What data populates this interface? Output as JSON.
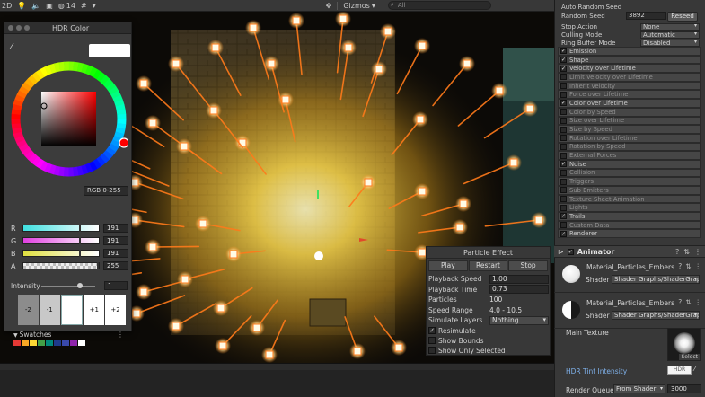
{
  "toolbar": {
    "layer_label": "2D",
    "fx_count": "14",
    "gizmos_label": "Gizmos",
    "search_placeholder": "All"
  },
  "hdr_color": {
    "title": "HDR Color",
    "color_model": "RGB 0-255",
    "channels": [
      {
        "label": "R",
        "value": "191",
        "fraction": 0.75
      },
      {
        "label": "G",
        "value": "191",
        "fraction": 0.75
      },
      {
        "label": "B",
        "value": "191",
        "fraction": 0.75
      },
      {
        "label": "A",
        "value": "255",
        "fraction": 1.0
      }
    ],
    "intensity_label": "Intensity",
    "intensity_value": "1",
    "exposure_steps": [
      "-2",
      "-1",
      "",
      "+1",
      "+2"
    ],
    "swatches_label": "Swatches",
    "swatch_colors": [
      "#e53935",
      "#f9a825",
      "#fdd835",
      "#43a047",
      "#00897b",
      "#1e3a8a",
      "#3949ab",
      "#8e24aa",
      "#ffffff"
    ]
  },
  "particle_effect": {
    "title": "Particle Effect",
    "buttons": [
      "Play",
      "Restart",
      "Stop"
    ],
    "playback_speed_label": "Playback Speed",
    "playback_speed": "1.00",
    "playback_time_label": "Playback Time",
    "playback_time": "0.73",
    "particles_label": "Particles",
    "particles": "100",
    "speed_range_label": "Speed Range",
    "speed_range": "4.0 - 10.5",
    "simulate_layers_label": "Simulate Layers",
    "simulate_layers": "Nothing",
    "checks": [
      {
        "label": "Resimulate",
        "checked": true
      },
      {
        "label": "Show Bounds",
        "checked": false
      },
      {
        "label": "Show Only Selected",
        "checked": false
      }
    ]
  },
  "inspector": {
    "auto_random_seed_label": "Auto Random Seed",
    "random_seed_label": "Random Seed",
    "random_seed": "3892",
    "reseed_label": "Reseed",
    "stop_action_label": "Stop Action",
    "stop_action": "None",
    "culling_mode_label": "Culling Mode",
    "culling_mode": "Automatic",
    "ring_buffer_label": "Ring Buffer Mode",
    "ring_buffer": "Disabled",
    "modules": [
      {
        "label": "Emission",
        "checked": true
      },
      {
        "label": "Shape",
        "checked": true
      },
      {
        "label": "Velocity over Lifetime",
        "checked": true
      },
      {
        "label": "Limit Velocity over Lifetime",
        "checked": false
      },
      {
        "label": "Inherit Velocity",
        "checked": false
      },
      {
        "label": "Force over Lifetime",
        "checked": false
      },
      {
        "label": "Color over Lifetime",
        "checked": true
      },
      {
        "label": "Color by Speed",
        "checked": false
      },
      {
        "label": "Size over Lifetime",
        "checked": false
      },
      {
        "label": "Size by Speed",
        "checked": false
      },
      {
        "label": "Rotation over Lifetime",
        "checked": false
      },
      {
        "label": "Rotation by Speed",
        "checked": false
      },
      {
        "label": "External Forces",
        "checked": false
      },
      {
        "label": "Noise",
        "checked": true
      },
      {
        "label": "Collision",
        "checked": false
      },
      {
        "label": "Triggers",
        "checked": false
      },
      {
        "label": "Sub Emitters",
        "checked": false
      },
      {
        "label": "Texture Sheet Animation",
        "checked": false
      },
      {
        "label": "Lights",
        "checked": false
      },
      {
        "label": "Trails",
        "checked": true
      },
      {
        "label": "Custom Data",
        "checked": false
      },
      {
        "label": "Renderer",
        "checked": true
      }
    ],
    "animator_label": "Animator",
    "materials": [
      {
        "name": "Material_Particles_Embers",
        "shader_label": "Shader",
        "shader": "Shader Graphs/ShaderGraph"
      },
      {
        "name": "Material_Particles_Embers",
        "shader_label": "Shader",
        "shader": "Shader Graphs/ShaderGraph"
      }
    ],
    "main_texture_label": "Main Texture",
    "select_label": "Select",
    "hdr_tint_label": "HDR Tint Intensity",
    "hdr_button_label": "HDR",
    "render_queue_label": "Render Queue",
    "render_queue_mode": "From Shader",
    "render_queue_value": "3000"
  },
  "colors": {
    "accent_blue": "#7fb1ea",
    "ember_orange": "#ff7a1a"
  }
}
